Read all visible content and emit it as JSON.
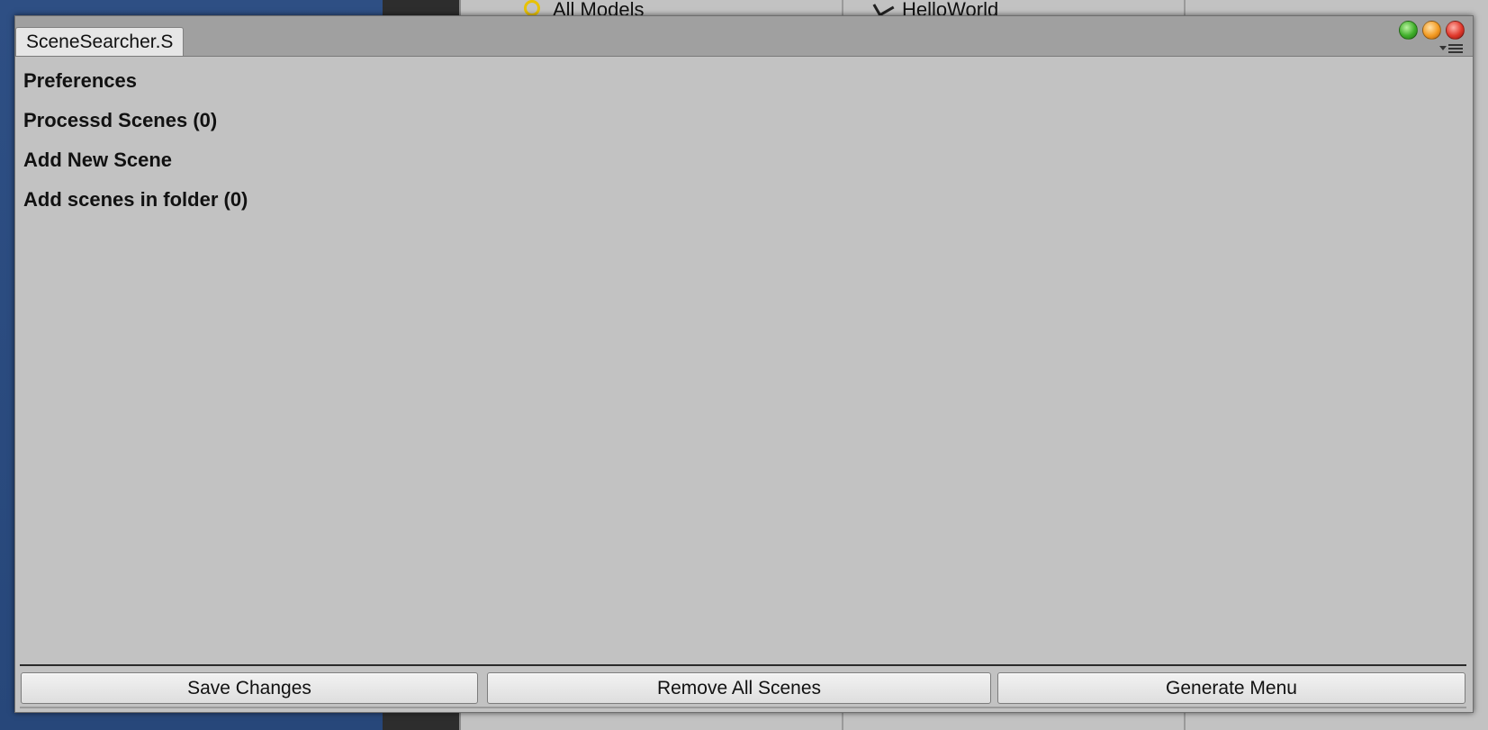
{
  "background": {
    "project_item": "All Models",
    "hierarchy_item": "HelloWorld"
  },
  "window": {
    "tab_title": "SceneSearcher.S",
    "foldouts": [
      {
        "label": "Preferences"
      },
      {
        "label": "Processd Scenes (0)"
      },
      {
        "label": "Add New Scene"
      },
      {
        "label": "Add scenes in folder (0)"
      }
    ],
    "buttons": {
      "save": "Save Changes",
      "remove_all": "Remove All Scenes",
      "generate_menu": "Generate Menu"
    }
  },
  "colors": {
    "panel": "#c2c2c2",
    "titlebar": "#a0a0a0",
    "desktop": "#2c4a7c"
  },
  "icons": [
    "window-close-icon",
    "window-minimize-icon",
    "window-zoom-icon",
    "context-menu-icon"
  ]
}
